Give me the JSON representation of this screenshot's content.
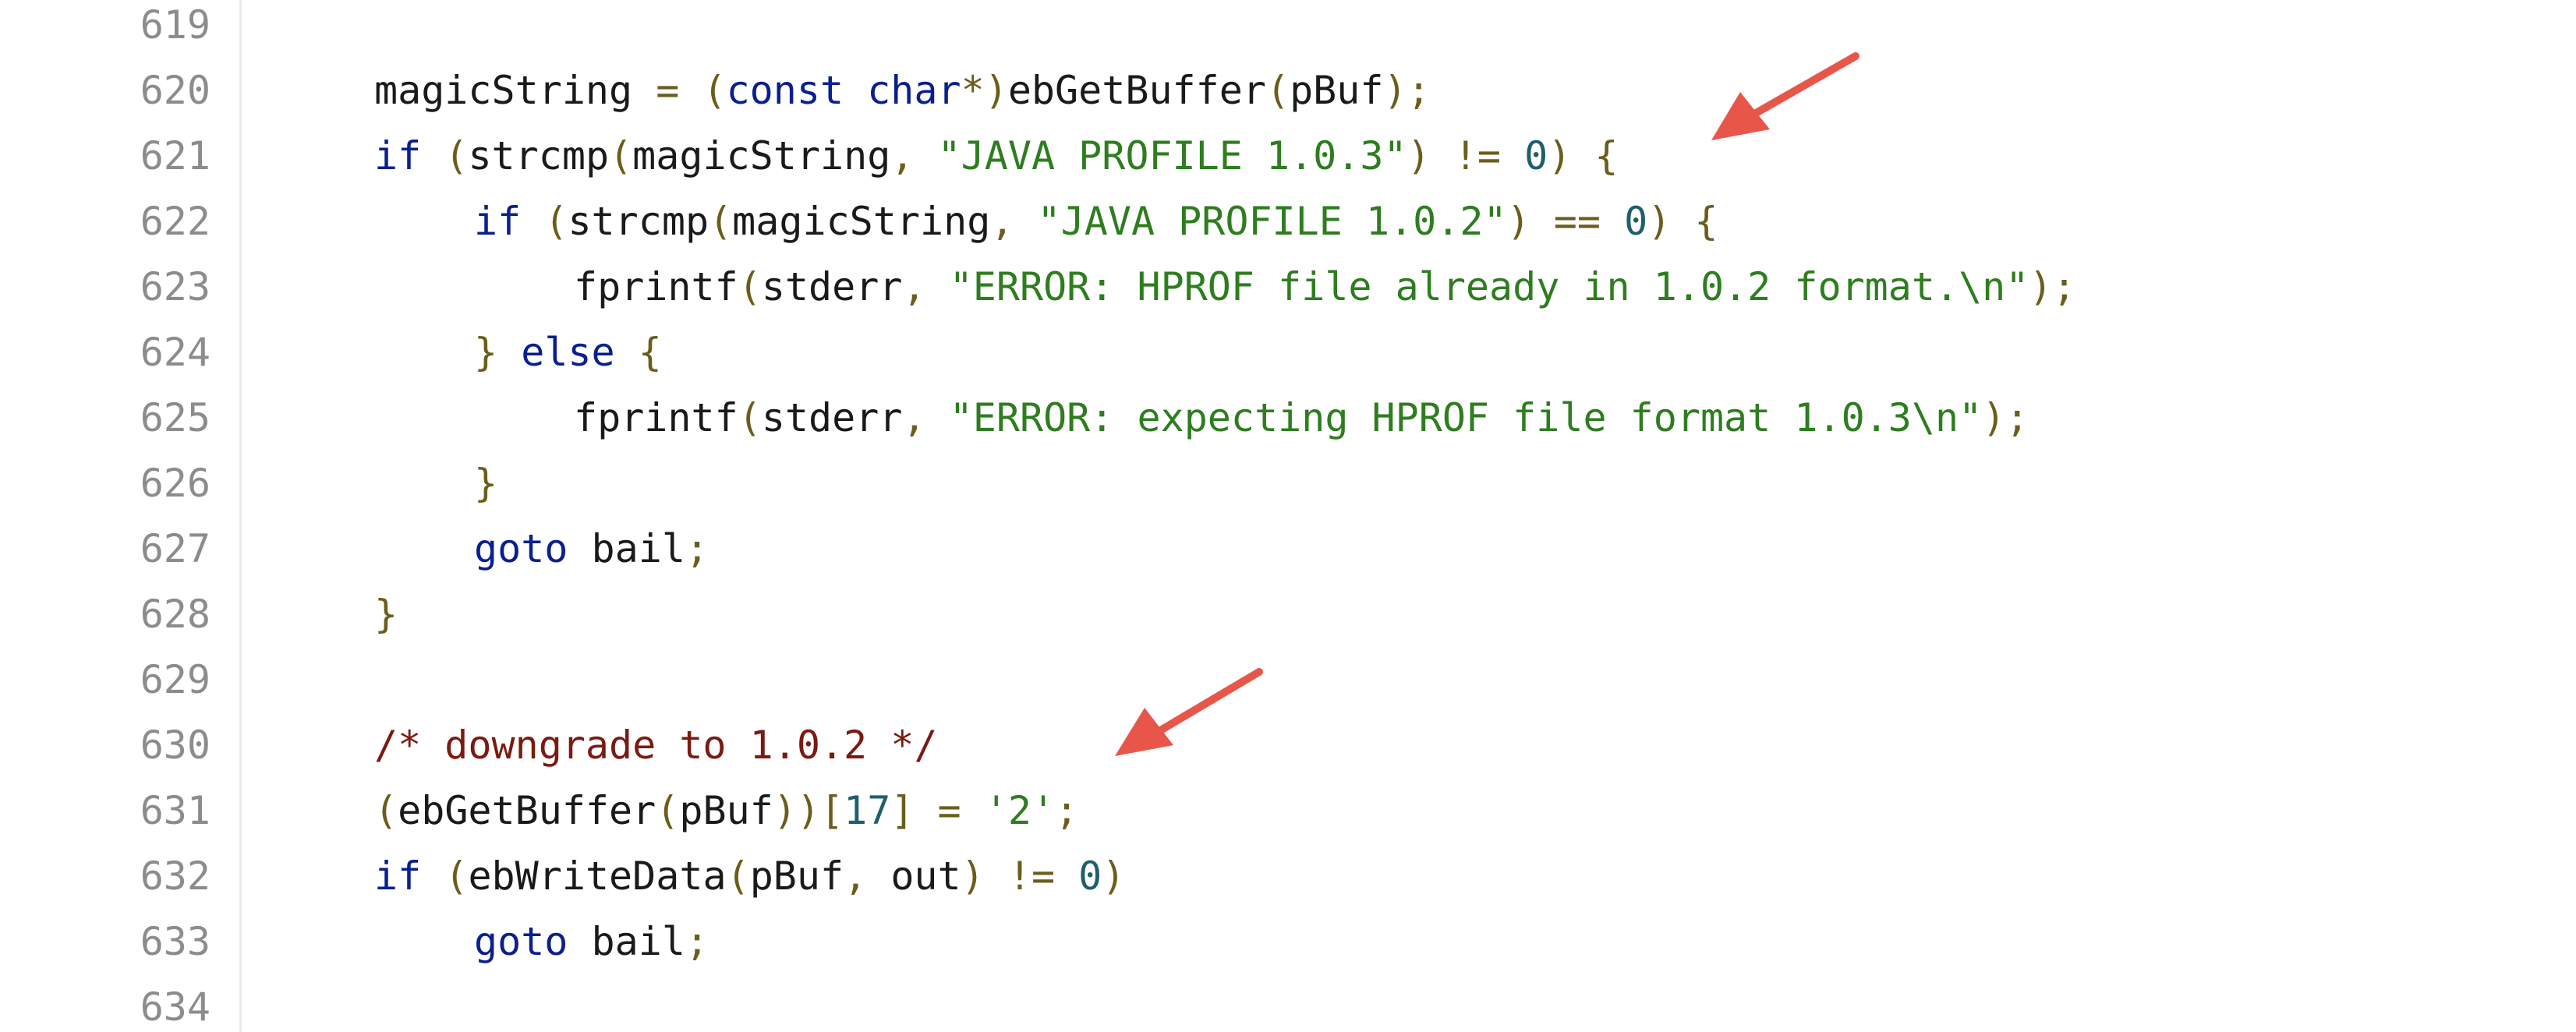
{
  "colors": {
    "keyword": "#0a1f8f",
    "string": "#2e7d1f",
    "comment": "#7a1a12",
    "number": "#1f5f6b",
    "punct": "#6b5d1a",
    "plain": "#1a1a1a",
    "line_number": "#8c8c8c",
    "arrow": "#e8564a"
  },
  "lines": [
    {
      "n": "619",
      "indent": "",
      "tokens": []
    },
    {
      "n": "620",
      "indent": "",
      "tokens": [
        {
          "t": "magicString",
          "k": "plain"
        },
        {
          "t": " = ",
          "k": "punct"
        },
        {
          "t": "(",
          "k": "punct"
        },
        {
          "t": "const",
          "k": "keyword"
        },
        {
          "t": " ",
          "k": "plain"
        },
        {
          "t": "char",
          "k": "keyword"
        },
        {
          "t": "*)",
          "k": "punct"
        },
        {
          "t": "ebGetBuffer",
          "k": "plain"
        },
        {
          "t": "(",
          "k": "punct"
        },
        {
          "t": "pBuf",
          "k": "plain"
        },
        {
          "t": ");",
          "k": "punct"
        }
      ]
    },
    {
      "n": "621",
      "indent": "",
      "tokens": [
        {
          "t": "if",
          "k": "keyword"
        },
        {
          "t": " (",
          "k": "punct"
        },
        {
          "t": "strcmp",
          "k": "plain"
        },
        {
          "t": "(",
          "k": "punct"
        },
        {
          "t": "magicString",
          "k": "plain"
        },
        {
          "t": ", ",
          "k": "punct"
        },
        {
          "t": "\"JAVA PROFILE 1.0.3\"",
          "k": "string"
        },
        {
          "t": ") != ",
          "k": "punct"
        },
        {
          "t": "0",
          "k": "number"
        },
        {
          "t": ") {",
          "k": "punct"
        }
      ]
    },
    {
      "n": "622",
      "indent": "    ",
      "tokens": [
        {
          "t": "if",
          "k": "keyword"
        },
        {
          "t": " (",
          "k": "punct"
        },
        {
          "t": "strcmp",
          "k": "plain"
        },
        {
          "t": "(",
          "k": "punct"
        },
        {
          "t": "magicString",
          "k": "plain"
        },
        {
          "t": ", ",
          "k": "punct"
        },
        {
          "t": "\"JAVA PROFILE 1.0.2\"",
          "k": "string"
        },
        {
          "t": ") == ",
          "k": "punct"
        },
        {
          "t": "0",
          "k": "number"
        },
        {
          "t": ") {",
          "k": "punct"
        }
      ]
    },
    {
      "n": "623",
      "indent": "        ",
      "tokens": [
        {
          "t": "fprintf",
          "k": "plain"
        },
        {
          "t": "(",
          "k": "punct"
        },
        {
          "t": "stderr",
          "k": "plain"
        },
        {
          "t": ", ",
          "k": "punct"
        },
        {
          "t": "\"ERROR: HPROF file already in 1.0.2 format.\\n\"",
          "k": "string"
        },
        {
          "t": ");",
          "k": "punct"
        }
      ]
    },
    {
      "n": "624",
      "indent": "    ",
      "tokens": [
        {
          "t": "} ",
          "k": "punct"
        },
        {
          "t": "else",
          "k": "keyword"
        },
        {
          "t": " {",
          "k": "punct"
        }
      ]
    },
    {
      "n": "625",
      "indent": "        ",
      "tokens": [
        {
          "t": "fprintf",
          "k": "plain"
        },
        {
          "t": "(",
          "k": "punct"
        },
        {
          "t": "stderr",
          "k": "plain"
        },
        {
          "t": ", ",
          "k": "punct"
        },
        {
          "t": "\"ERROR: expecting HPROF file format 1.0.3\\n\"",
          "k": "string"
        },
        {
          "t": ");",
          "k": "punct"
        }
      ]
    },
    {
      "n": "626",
      "indent": "    ",
      "tokens": [
        {
          "t": "}",
          "k": "punct"
        }
      ]
    },
    {
      "n": "627",
      "indent": "    ",
      "tokens": [
        {
          "t": "goto",
          "k": "keyword"
        },
        {
          "t": " bail",
          "k": "plain"
        },
        {
          "t": ";",
          "k": "punct"
        }
      ]
    },
    {
      "n": "628",
      "indent": "",
      "tokens": [
        {
          "t": "}",
          "k": "punct"
        }
      ]
    },
    {
      "n": "629",
      "indent": "",
      "tokens": []
    },
    {
      "n": "630",
      "indent": "",
      "tokens": [
        {
          "t": "/* downgrade to 1.0.2 */",
          "k": "comment"
        }
      ]
    },
    {
      "n": "631",
      "indent": "",
      "tokens": [
        {
          "t": "(",
          "k": "punct"
        },
        {
          "t": "ebGetBuffer",
          "k": "plain"
        },
        {
          "t": "(",
          "k": "punct"
        },
        {
          "t": "pBuf",
          "k": "plain"
        },
        {
          "t": "))[",
          "k": "punct"
        },
        {
          "t": "17",
          "k": "number"
        },
        {
          "t": "] = ",
          "k": "punct"
        },
        {
          "t": "'2'",
          "k": "string"
        },
        {
          "t": ";",
          "k": "punct"
        }
      ]
    },
    {
      "n": "632",
      "indent": "",
      "tokens": [
        {
          "t": "if",
          "k": "keyword"
        },
        {
          "t": " (",
          "k": "punct"
        },
        {
          "t": "ebWriteData",
          "k": "plain"
        },
        {
          "t": "(",
          "k": "punct"
        },
        {
          "t": "pBuf",
          "k": "plain"
        },
        {
          "t": ", ",
          "k": "punct"
        },
        {
          "t": "out",
          "k": "plain"
        },
        {
          "t": ") != ",
          "k": "punct"
        },
        {
          "t": "0",
          "k": "number"
        },
        {
          "t": ")",
          "k": "punct"
        }
      ]
    },
    {
      "n": "633",
      "indent": "    ",
      "tokens": [
        {
          "t": "goto",
          "k": "keyword"
        },
        {
          "t": " bail",
          "k": "plain"
        },
        {
          "t": ";",
          "k": "punct"
        }
      ]
    },
    {
      "n": "634",
      "indent": "",
      "tokens": []
    }
  ],
  "annotations": [
    {
      "name": "arrow-annotation-line-621",
      "points_to_line": "621",
      "icon": "arrow-icon"
    },
    {
      "name": "arrow-annotation-line-630",
      "points_to_line": "630",
      "icon": "arrow-icon"
    }
  ]
}
